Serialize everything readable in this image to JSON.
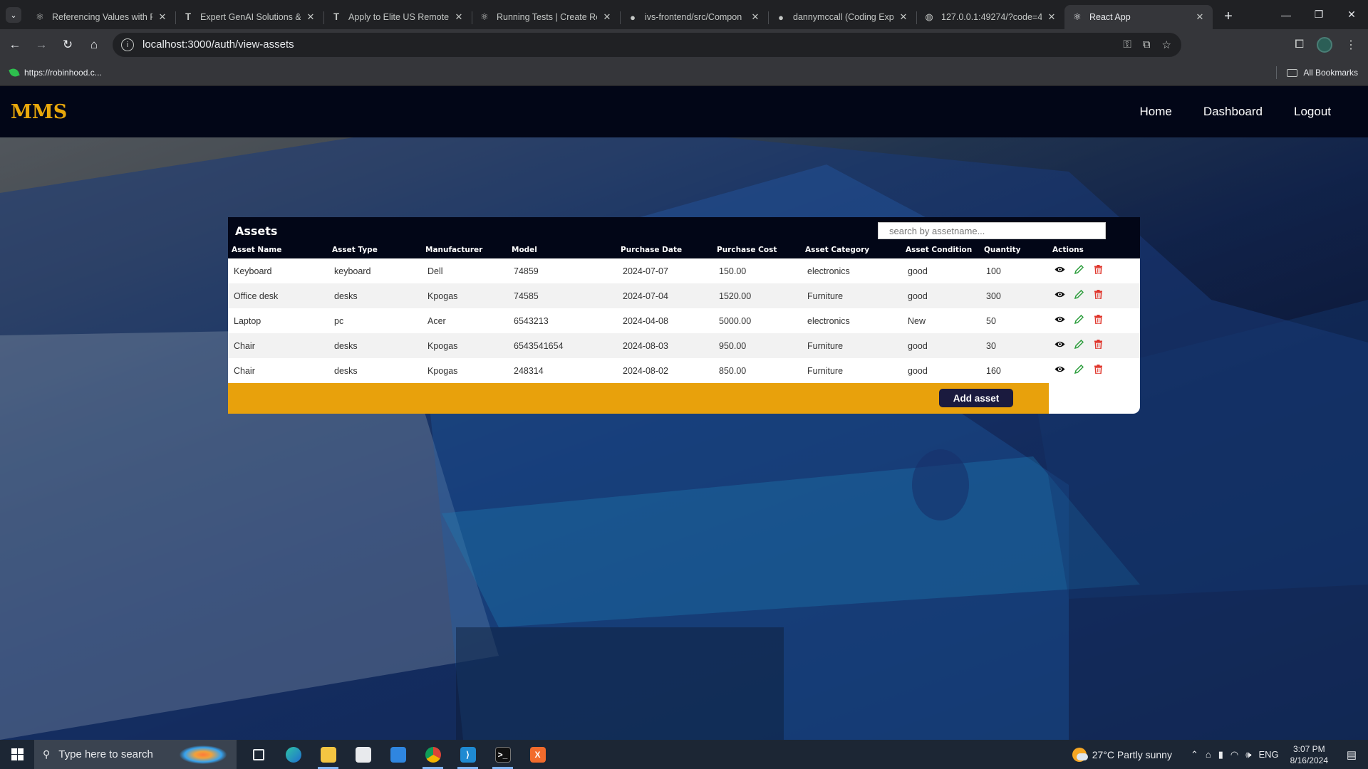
{
  "browser": {
    "tabs": [
      {
        "title": "Referencing Values with R",
        "icon": "react-icon",
        "active": false
      },
      {
        "title": "Expert GenAI Solutions &",
        "icon": "t-logo-icon",
        "active": false
      },
      {
        "title": "Apply to Elite US Remote",
        "icon": "t-logo-icon",
        "active": false
      },
      {
        "title": "Running Tests | Create Re",
        "icon": "react-icon",
        "active": false
      },
      {
        "title": "ivs-frontend/src/Compon",
        "icon": "github-icon",
        "active": false
      },
      {
        "title": "dannymccall (Coding Exp",
        "icon": "github-icon",
        "active": false
      },
      {
        "title": "127.0.0.1:49274/?code=4",
        "icon": "globe-icon",
        "active": false
      },
      {
        "title": "React App",
        "icon": "react-icon",
        "active": true
      }
    ],
    "url": "localhost:3000/auth/view-assets",
    "bookmark": "https://robinhood.c...",
    "all_bookmarks": "All Bookmarks"
  },
  "app": {
    "logo": "MMS",
    "nav": {
      "home": "Home",
      "dashboard": "Dashboard",
      "logout": "Logout"
    }
  },
  "assets": {
    "title": "Assets",
    "search_placeholder": "search by assetname...",
    "columns": [
      "Asset Name",
      "Asset Type",
      "Manufacturer",
      "Model",
      "Purchase Date",
      "Purchase Cost",
      "Asset Category",
      "Asset Condition",
      "Quantity",
      "Actions"
    ],
    "rows": [
      {
        "name": "Keyboard",
        "type": "keyboard",
        "manufacturer": "Dell",
        "model": "74859",
        "date": "2024-07-07",
        "cost": "150.00",
        "category": "electronics",
        "condition": "good",
        "quantity": "100"
      },
      {
        "name": "Office desk",
        "type": "desks",
        "manufacturer": "Kpogas",
        "model": "74585",
        "date": "2024-07-04",
        "cost": "1520.00",
        "category": "Furniture",
        "condition": "good",
        "quantity": "300"
      },
      {
        "name": "Laptop",
        "type": "pc",
        "manufacturer": "Acer",
        "model": "6543213",
        "date": "2024-04-08",
        "cost": "5000.00",
        "category": "electronics",
        "condition": "New",
        "quantity": "50"
      },
      {
        "name": "Chair",
        "type": "desks",
        "manufacturer": "Kpogas",
        "model": "6543541654",
        "date": "2024-08-03",
        "cost": "950.00",
        "category": "Furniture",
        "condition": "good",
        "quantity": "30"
      },
      {
        "name": "Chair",
        "type": "desks",
        "manufacturer": "Kpogas",
        "model": "248314",
        "date": "2024-08-02",
        "cost": "850.00",
        "category": "Furniture",
        "condition": "good",
        "quantity": "160"
      }
    ],
    "add_button": "Add asset"
  },
  "colors": {
    "accent": "#e8a10c",
    "navbar": "#020617",
    "button": "#1a1a3e",
    "edit": "#2e9e3e",
    "delete": "#e0362c"
  },
  "taskbar": {
    "search_placeholder": "Type here to search",
    "weather": "27°C  Partly sunny",
    "lang": "ENG",
    "time": "3:07 PM",
    "date": "8/16/2024"
  }
}
